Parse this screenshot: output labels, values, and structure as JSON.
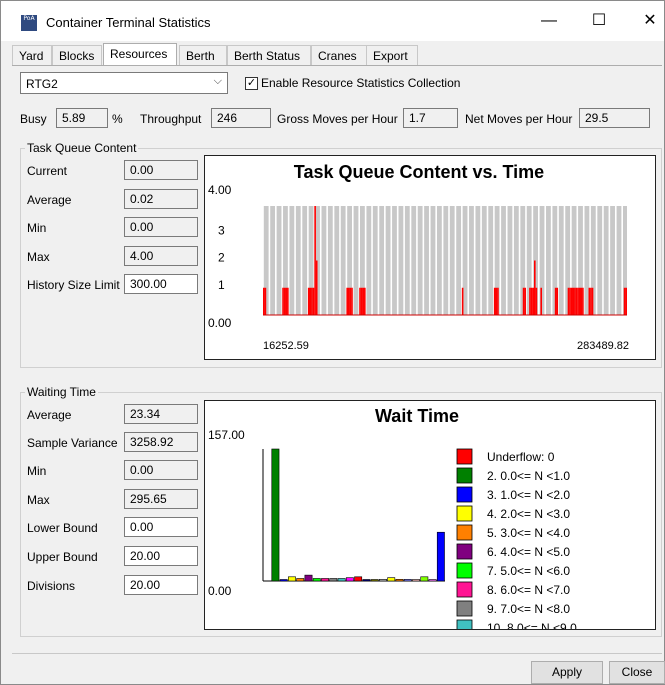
{
  "window": {
    "title": "Container Terminal Statistics",
    "icon_text": "PoA",
    "minimize_glyph": "—",
    "maximize_glyph": "☐",
    "close_glyph": "✕"
  },
  "tabs": [
    "Yard",
    "Blocks",
    "Resources",
    "Berth",
    "Berth Status",
    "Cranes",
    "Export"
  ],
  "active_tab": "Resources",
  "resource_select": {
    "value": "RTG2",
    "arrow": "⌵"
  },
  "enable_stats": {
    "label": "Enable Resource Statistics Collection",
    "checked": true,
    "mark": "✓"
  },
  "summary": {
    "busy_label": "Busy",
    "busy_value": "5.89",
    "busy_unit": "%",
    "throughput_label": "Throughput",
    "throughput_value": "246",
    "gross_label": "Gross Moves per Hour",
    "gross_value": "1.7",
    "net_label": "Net Moves per Hour",
    "net_value": "29.5"
  },
  "task_queue": {
    "group_title": "Task Queue Content",
    "rows": [
      {
        "label": "Current",
        "value": "0.00"
      },
      {
        "label": "Average",
        "value": "0.02"
      },
      {
        "label": "Min",
        "value": "0.00"
      },
      {
        "label": "Max",
        "value": "4.00"
      },
      {
        "label": "History Size Limit",
        "value": "300.00"
      }
    ]
  },
  "waiting_time": {
    "group_title": "Waiting Time",
    "rows": [
      {
        "label": "Average",
        "value": "23.34"
      },
      {
        "label": "Sample Variance",
        "value": "3258.92"
      },
      {
        "label": "Min",
        "value": "0.00"
      },
      {
        "label": "Max",
        "value": "295.65"
      },
      {
        "label": "Lower Bound",
        "value": "0.00"
      },
      {
        "label": "Upper Bound",
        "value": "20.00"
      },
      {
        "label": "Divisions",
        "value": "20.00"
      }
    ]
  },
  "chart_data": [
    {
      "type": "bar",
      "title": "Task Queue Content vs. Time",
      "y_max_label": "4.00",
      "y_min_label": "0.00",
      "y_ticks": [
        "3",
        "2",
        "1"
      ],
      "x_start_label": "16252.59",
      "x_end_label": "283489.82",
      "ylim": [
        0,
        4
      ],
      "grid": true,
      "bar_color": "#ff0000",
      "values": [
        1,
        1,
        0,
        0,
        0,
        0,
        0,
        0,
        0,
        0,
        0,
        0,
        1,
        1,
        1,
        1,
        0,
        0,
        0,
        0,
        0,
        0,
        0,
        0,
        0,
        0,
        0,
        0,
        1,
        1,
        1,
        1,
        4,
        2,
        0,
        0,
        0,
        0,
        0,
        0,
        0,
        0,
        0,
        0,
        0,
        0,
        0,
        0,
        0,
        0,
        0,
        0,
        1,
        1,
        1,
        1,
        0,
        0,
        0,
        0,
        1,
        1,
        1,
        1,
        0,
        0,
        0,
        0,
        0,
        0,
        0,
        0,
        0,
        0,
        0,
        0,
        0,
        0,
        0,
        0,
        0,
        0,
        0,
        0,
        0,
        0,
        0,
        0,
        0,
        0,
        0,
        0,
        0,
        0,
        0,
        0,
        0,
        0,
        0,
        0,
        0,
        0,
        0,
        0,
        0,
        0,
        0,
        0,
        0,
        0,
        0,
        0,
        0,
        0,
        0,
        0,
        0,
        0,
        0,
        0,
        0,
        0,
        0,
        0,
        1,
        0,
        0,
        0,
        0,
        0,
        0,
        0,
        0,
        0,
        0,
        0,
        0,
        0,
        0,
        0,
        0,
        0,
        0,
        0,
        1,
        1,
        1,
        0,
        0,
        0,
        0,
        0,
        0,
        0,
        0,
        0,
        0,
        0,
        0,
        0,
        0,
        0,
        1,
        1,
        0,
        0,
        1,
        1,
        1,
        2,
        1,
        0,
        0,
        1,
        0,
        0,
        0,
        0,
        0,
        0,
        0,
        0,
        1,
        1,
        0,
        0,
        0,
        0,
        0,
        0,
        1,
        1,
        1,
        1,
        1,
        1,
        1,
        1,
        1,
        1,
        0,
        0,
        0,
        1,
        1,
        1,
        0,
        0,
        0,
        0,
        0,
        0,
        0,
        0,
        0,
        0,
        0,
        0,
        0,
        0,
        0,
        0,
        0,
        0,
        0,
        1,
        1
      ]
    },
    {
      "type": "bar",
      "title": "Wait Time",
      "y_max_label": "157.00",
      "y_min_label": "0.00",
      "ylim": [
        0,
        157
      ],
      "categories": [
        "Underflow: 0",
        "2. 0.0<= N <1.0",
        "3. 1.0<= N <2.0",
        "4. 2.0<= N <3.0",
        "5. 3.0<= N <4.0",
        "6. 4.0<= N <5.0",
        "7. 5.0<= N <6.0",
        "8. 6.0<= N <7.0",
        "9. 7.0<= N <8.0",
        "10. 8.0<= N <9.0"
      ],
      "legend_colors": [
        "#ff0000",
        "#008000",
        "#0000ff",
        "#ffff00",
        "#ff8000",
        "#800080",
        "#00ff00",
        "#ff1493",
        "#808080",
        "#40c0c0"
      ],
      "bars": [
        {
          "value": 0,
          "color": "#ff0000"
        },
        {
          "value": 157,
          "color": "#008000"
        },
        {
          "value": 1,
          "color": "#0000ff"
        },
        {
          "value": 5,
          "color": "#ffff00"
        },
        {
          "value": 3,
          "color": "#ff8000"
        },
        {
          "value": 7,
          "color": "#800080"
        },
        {
          "value": 3,
          "color": "#00ff00"
        },
        {
          "value": 3,
          "color": "#ff1493"
        },
        {
          "value": 3,
          "color": "#808080"
        },
        {
          "value": 3,
          "color": "#40c0c0"
        },
        {
          "value": 4,
          "color": "#ff00ff"
        },
        {
          "value": 5,
          "color": "#ff0000"
        },
        {
          "value": 1,
          "color": "#000080"
        },
        {
          "value": 1,
          "color": "#808000"
        },
        {
          "value": 2,
          "color": "#c0c0c0"
        },
        {
          "value": 4,
          "color": "#ffff00"
        },
        {
          "value": 2,
          "color": "#ff8000"
        },
        {
          "value": 2,
          "color": "#8080ff"
        },
        {
          "value": 1,
          "color": "#ffc0c0"
        },
        {
          "value": 5,
          "color": "#80ff00"
        },
        {
          "value": 1,
          "color": "#ff80ff"
        },
        {
          "value": 58,
          "color": "#0000ff"
        }
      ]
    }
  ],
  "buttons": {
    "apply": "Apply",
    "close": "Close"
  }
}
